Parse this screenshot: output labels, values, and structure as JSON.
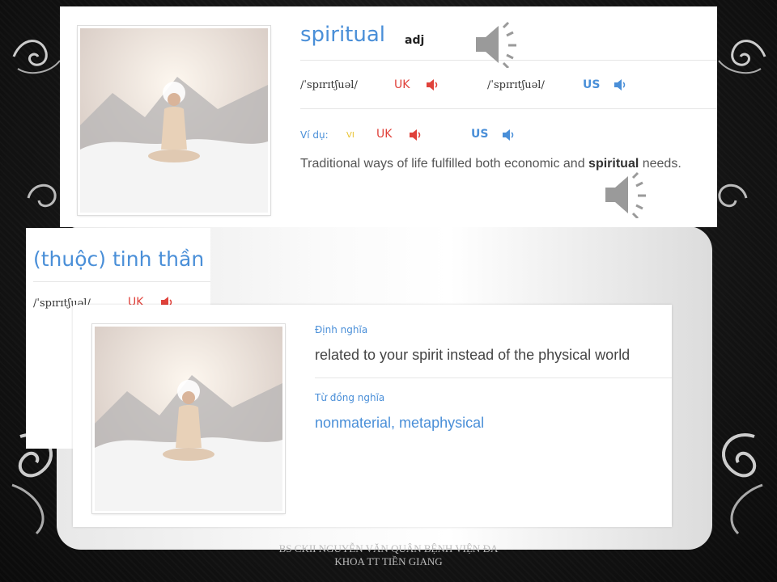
{
  "top_card": {
    "word": "spiritual",
    "pos": "adj",
    "ipa_uk": "/ˈspɪrɪtʃuəl/",
    "uk_label": "UK",
    "ipa_us": "/ˈspɪrɪtʃuəl/",
    "us_label": "US",
    "example_label": "Ví dụ:",
    "vi_label": "VI",
    "uk_label2": "UK",
    "us_label2": "US",
    "example_before": "Traditional ways of life fulfilled both economic and ",
    "example_bold": "spiritual",
    "example_after": " needs."
  },
  "middle_card": {
    "translation": "(thuộc) tinh thần",
    "ipa": "/ˈspɪrɪtʃuəl/",
    "uk_label": "UK"
  },
  "bottom_card": {
    "definition_label": "Định nghĩa",
    "definition": "related to your spirit instead of the physical world",
    "synonym_label": "Từ đồng nghĩa",
    "synonyms": "nonmaterial, metaphysical"
  },
  "footer": {
    "line1": "BS CKII NGUYỄN VĂN QUÂN BỆNH VIỆN ĐA",
    "line2": "KHOA TT TIỀN GIANG"
  },
  "colors": {
    "blue": "#4a8fd8",
    "red": "#e0423b",
    "gold": "#e8c22c"
  },
  "icons": [
    "speaker-icon",
    "meditation-image",
    "ornament"
  ]
}
